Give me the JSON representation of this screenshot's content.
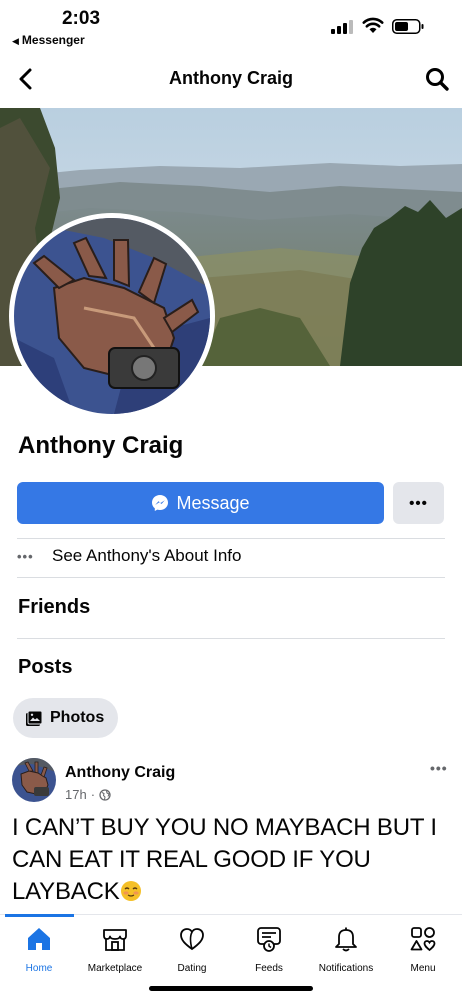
{
  "status_bar": {
    "time": "2:03",
    "back_app": "Messenger"
  },
  "header": {
    "title": "Anthony Craig"
  },
  "profile": {
    "name": "Anthony Craig",
    "message_button": "Message",
    "about_link": "See Anthony's About Info",
    "friends_heading": "Friends",
    "posts_heading": "Posts",
    "photos_chip": "Photos"
  },
  "post": {
    "author": "Anthony Craig",
    "time": "17h",
    "text": "I CAN’T BUY YOU NO MAYBACH BUT I CAN EAT IT REAL GOOD IF YOU LAYBACK"
  },
  "tabs": [
    {
      "label": "Home",
      "icon": "home-icon",
      "active": true
    },
    {
      "label": "Marketplace",
      "icon": "marketplace-icon"
    },
    {
      "label": "Dating",
      "icon": "dating-icon"
    },
    {
      "label": "Feeds",
      "icon": "feeds-icon"
    },
    {
      "label": "Notifications",
      "icon": "bell-icon"
    },
    {
      "label": "Menu",
      "icon": "menu-icon"
    }
  ],
  "colors": {
    "accent": "#1b74e4",
    "message_button": "#3578e5",
    "secondary_button": "#e4e6eb"
  }
}
